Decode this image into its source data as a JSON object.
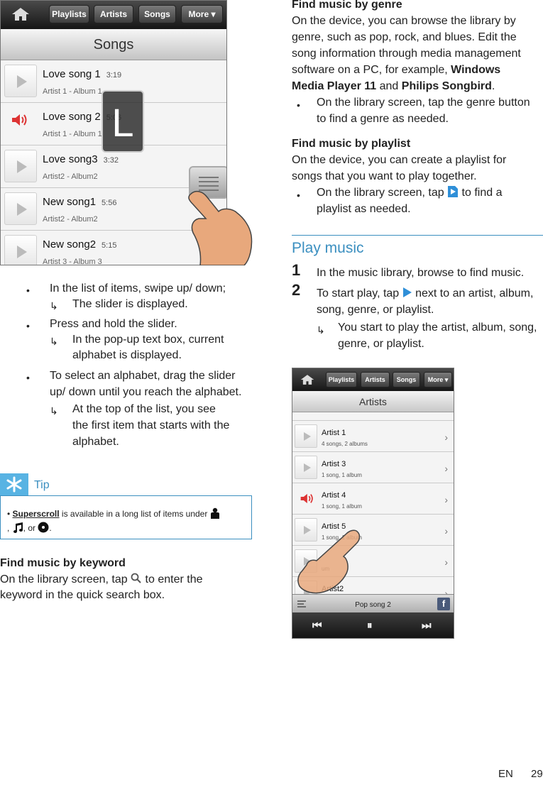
{
  "phone1": {
    "tabs": [
      "Playlists",
      "Artists",
      "Songs",
      "More ▾"
    ],
    "header": "Songs",
    "songs": [
      {
        "title": "Love song 1",
        "duration": "3:19",
        "sub": "Artist 1  -  Album 1",
        "playing": false
      },
      {
        "title": "Love song 2",
        "duration": "5:06",
        "sub": "Artist 1  -  Album 1",
        "playing": true
      },
      {
        "title": "Love song3",
        "duration": "3:32",
        "sub": "Artist2  -  Album2",
        "playing": false
      },
      {
        "title": "New song1",
        "duration": "5:56",
        "sub": "Artist2  -  Album2",
        "playing": false
      },
      {
        "title": "New song2",
        "duration": "5:15",
        "sub": "Artist 3  -  Album 3",
        "playing": false
      }
    ],
    "popup_letter": "L"
  },
  "left": {
    "b1": "In the list of items, swipe up/ down;",
    "r1": "The slider is displayed.",
    "b2": "Press and hold the slider.",
    "r2a": "In the pop-up text box, current",
    "r2b": "alphabet is displayed.",
    "b3a": "To select an alphabet, drag the slider",
    "b3b": "up/ down until you reach the alphabet.",
    "r3a": "At the top of the list, you see",
    "r3b": "the first item that starts with the",
    "r3c": "alphabet.",
    "tip_label": "Tip",
    "tip_bold": "Superscroll",
    "tip_text": " is available in a long list of items under ",
    "tip_sep1": ", ",
    "tip_sep2": ", or ",
    "tip_end": ".",
    "kw_title": "Find music by keyword",
    "kw_1a": "On the library screen, tap ",
    "kw_1b": " to enter the",
    "kw_2": "keyword in the quick search box."
  },
  "right": {
    "genre_title": "Find music by genre",
    "g1": "On the device, you can browse the library by",
    "g2": "genre, such as pop, rock, and blues. Edit the",
    "g3": "song information through media management",
    "g4a": "software on a PC, for example, ",
    "g4b": "Windows",
    "g5a": "Media Player 11",
    "g5b": " and ",
    "g5c": "Philips Songbird",
    "g5d": ".",
    "gb1": "On the library screen, tap the genre button",
    "gb2": "to find a genre as needed.",
    "pl_title": "Find music by playlist",
    "p1": "On the device, you can create a playlist for",
    "p2": "songs that you want to play together.",
    "pb1a": "On the library screen, tap ",
    "pb1b": " to find a",
    "pb2": "playlist as needed.",
    "play_title": "Play music",
    "s1num": "1",
    "s1": "In the music library, browse to find music.",
    "s2num": "2",
    "s2a": "To start play, tap ",
    "s2b": " next to an artist, album,",
    "s2c": "song, genre, or playlist.",
    "s2r1": "You start to play the artist, album, song,",
    "s2r2": "genre, or playlist."
  },
  "phone2": {
    "tabs": [
      "Playlists",
      "Artists",
      "Songs",
      "More ▾"
    ],
    "header": "Artists",
    "artists": [
      {
        "name": "Artist 1",
        "sub": "4 songs, 2 albums",
        "playing": false
      },
      {
        "name": "Artist 3",
        "sub": "1 song, 1 album",
        "playing": false
      },
      {
        "name": "Artist 4",
        "sub": "1 song, 1 album",
        "playing": true
      },
      {
        "name": "Artist 5",
        "sub": "1 song, 1 album",
        "playing": false
      },
      {
        "name": "",
        "sub": "um",
        "playing": false
      },
      {
        "name": "Artist2",
        "sub": "",
        "playing": false
      }
    ],
    "now_playing": "Pop song 2"
  },
  "footer": {
    "lang": "EN",
    "page": "29"
  }
}
